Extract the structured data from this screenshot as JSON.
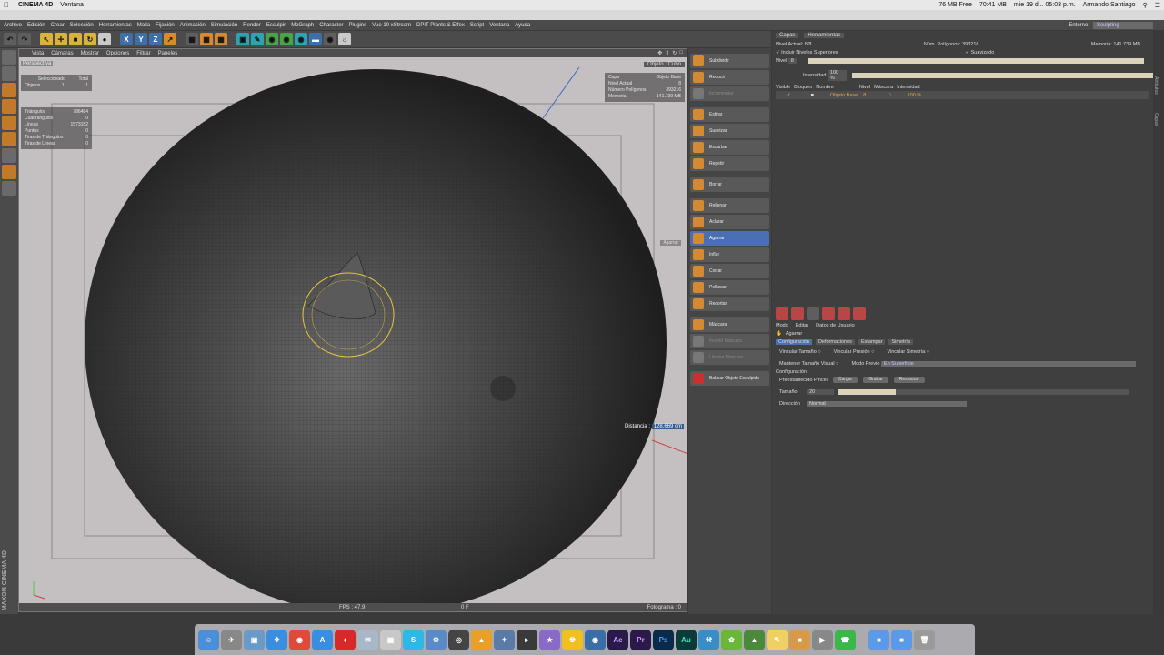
{
  "macbar": {
    "app": "CINEMA 4D",
    "menu": "Ventana",
    "memory": "76 MB Free",
    "power": "70:41 MB",
    "date": "mie 19 d... 05:03 p.m.",
    "user": "Armando Santiago"
  },
  "c4d_menu": [
    "Archivo",
    "Edición",
    "Crear",
    "Selección",
    "Herramientas",
    "Malla",
    "Fijación",
    "Animación",
    "Simulación",
    "Render",
    "Esculpir",
    "MoGraph",
    "Character",
    "Plugins",
    "Vue 10 xStream",
    "DPIT Plants & Effex",
    "Script",
    "Ventana",
    "Ayuda"
  ],
  "environment": {
    "label": "Entorno:",
    "value": "Sculpting"
  },
  "viewport": {
    "menu": [
      "Vista",
      "Cámaras",
      "Mostrar",
      "Opciones",
      "Filtrar",
      "Paneles"
    ],
    "title": "Perspectiva",
    "object_label": "Objeto : Cubo",
    "selection": {
      "header_sel": "Seleccionado",
      "header_total": "Total",
      "label": "Objetos",
      "sel": "1",
      "total": "1"
    },
    "stats": [
      {
        "k": "Triángulos",
        "v": "786484"
      },
      {
        "k": "Cuadrángulos",
        "v": "0"
      },
      {
        "k": "Líneas",
        "v": "1573152"
      },
      {
        "k": "Puntos",
        "v": "0"
      },
      {
        "k": "Tiras de Triángulos",
        "v": "0"
      },
      {
        "k": "Tiras de Líneas",
        "v": "0"
      }
    ],
    "layer_info": [
      {
        "k": "Capa",
        "v": "Objeto Base"
      },
      {
        "k": "Nivel Actual",
        "v": "8"
      },
      {
        "k": "Número Polígonos",
        "v": "393216"
      },
      {
        "k": "Memoria",
        "v": "141.739 MB"
      }
    ],
    "distance_label": "Distancia :",
    "distance_value": "128.669 cm",
    "tool_tip": "Agarrar",
    "fps": "FPS : 47.9",
    "frame": "0 F",
    "footer_right": "Fotograma : 0"
  },
  "sculpt_tools": [
    {
      "label": "Subdividir",
      "state": "normal"
    },
    {
      "label": "Reducir",
      "state": "normal"
    },
    {
      "label": "Incrementar",
      "state": "dim"
    },
    {
      "label": "Estirar",
      "state": "normal"
    },
    {
      "label": "Suavizar",
      "state": "normal"
    },
    {
      "label": "Escarbar",
      "state": "normal"
    },
    {
      "label": "Repetir",
      "state": "normal"
    },
    {
      "label": "Borrar",
      "state": "normal"
    },
    {
      "label": "Rellenar",
      "state": "normal"
    },
    {
      "label": "Aclarar",
      "state": "normal"
    },
    {
      "label": "Agarrar",
      "state": "active"
    },
    {
      "label": "Inflar",
      "state": "normal"
    },
    {
      "label": "Cortar",
      "state": "normal"
    },
    {
      "label": "Pellizcar",
      "state": "normal"
    },
    {
      "label": "Recortar",
      "state": "normal"
    },
    {
      "label": "Máscara",
      "state": "normal"
    },
    {
      "label": "Invertir Máscara",
      "state": "dim"
    },
    {
      "label": "Limpiar Máscara",
      "state": "dim"
    },
    {
      "label": "Bakear Objeto Esculpido",
      "state": "red"
    }
  ],
  "layers_panel": {
    "tabs": [
      "Capas",
      "Herramientas"
    ],
    "nivel_actual": "Nivel Actual: 8/8",
    "num_poligonos": "Núm. Polígonos: 393216",
    "memoria": "Memoria: 141.739 MB",
    "incluir": "Incluir Niveles Superiores",
    "suavizado": "Suavizado",
    "nivel_label": "Nivel",
    "nivel_value": "8",
    "intensidad_label": "Intensidad",
    "intensidad_value": "100 %",
    "columns": [
      "Visible",
      "Bloqueo",
      "Nombre",
      "Nivel",
      "Máscara",
      "Intensidad"
    ],
    "row": {
      "name": "Objeto Base",
      "level": "8",
      "intensity": "100 %"
    }
  },
  "attributes": {
    "menu": [
      "Modo",
      "Editar",
      "Datos de Usuario"
    ],
    "tool_name": "Agarrar",
    "tabs": [
      "Configuración",
      "Deformaciones",
      "Estampar",
      "Simetría"
    ],
    "vincular_tamano": "Vincular Tamaño",
    "vincular_presion": "Vincular Presión",
    "vincular_simetria": "Vincular Simetría",
    "mantener": "Mantener Tamaño Visual",
    "modo_previo_label": "Modo Previo",
    "modo_previo_value": "En Superficie",
    "config_header": "Configuración",
    "preset_label": "Preestablecido Pincel",
    "cargar": "Cargar",
    "grabar": "Grabar",
    "restaurar": "Restaurar",
    "tamano_label": "Tamaño",
    "tamano_value": "20",
    "direccion_label": "Dirección",
    "direccion_value": "Normal"
  },
  "side_tabs": [
    "Atributos",
    "Capas"
  ],
  "colors": {
    "viewport_bg": "#c4bfc0",
    "active_tool": "#4a6fb5",
    "accent_orange": "#d48a35"
  }
}
